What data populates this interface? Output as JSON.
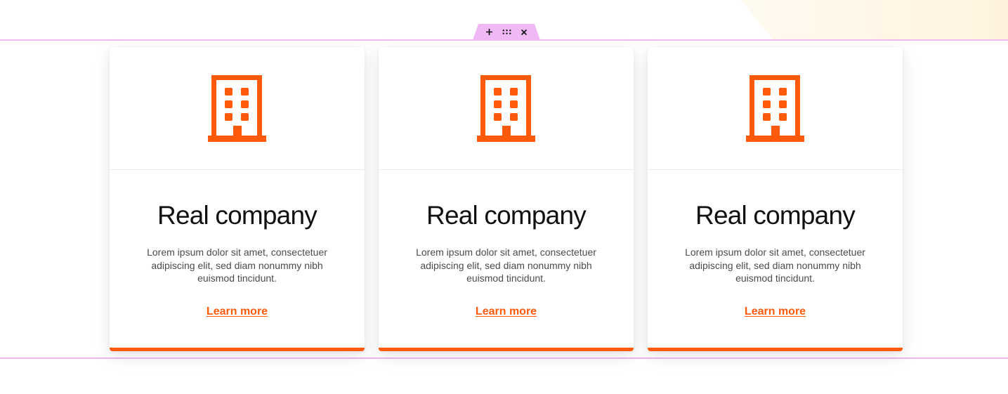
{
  "colors": {
    "accent": "#ff5a0a",
    "outline": "#f1b8f6",
    "title": "#111111",
    "body_text": "#4b4b4b"
  },
  "toolbar": {
    "add_icon": "plus-icon",
    "drag_icon": "grip-dots-icon",
    "close_icon": "close-icon"
  },
  "cards": [
    {
      "icon": "building-icon",
      "title": "Real company",
      "text": "Lorem ipsum dolor sit amet, consectetuer adipiscing elit, sed diam nonummy nibh euismod tincidunt.",
      "link": "Learn more"
    },
    {
      "icon": "building-icon",
      "title": "Real company",
      "text": "Lorem ipsum dolor sit amet, consectetuer adipiscing elit, sed diam nonummy nibh euismod tincidunt.",
      "link": "Learn more"
    },
    {
      "icon": "building-icon",
      "title": "Real company",
      "text": "Lorem ipsum dolor sit amet, consectetuer adipiscing elit, sed diam nonummy nibh euismod tincidunt.",
      "link": "Learn more"
    }
  ]
}
